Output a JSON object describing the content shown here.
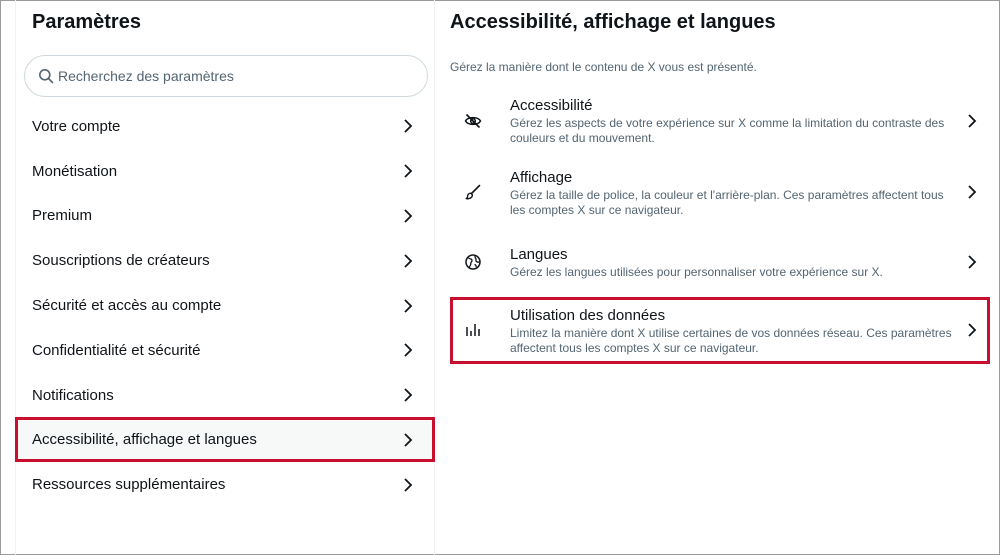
{
  "left": {
    "title": "Paramètres",
    "search_placeholder": "Recherchez des paramètres",
    "items": [
      {
        "label": "Votre compte"
      },
      {
        "label": "Monétisation"
      },
      {
        "label": "Premium"
      },
      {
        "label": "Souscriptions de créateurs"
      },
      {
        "label": "Sécurité et accès au compte"
      },
      {
        "label": "Confidentialité et sécurité"
      },
      {
        "label": "Notifications"
      },
      {
        "label": "Accessibilité, affichage et langues"
      },
      {
        "label": "Ressources supplémentaires"
      }
    ]
  },
  "right": {
    "title": "Accessibilité, affichage et langues",
    "subtitle": "Gérez la manière dont le contenu de X vous est présenté.",
    "options": [
      {
        "label": "Accessibilité",
        "desc": "Gérez les aspects de votre expérience sur X comme la limitation du contraste des couleurs et du mouvement.",
        "icon": "eye-slash-icon"
      },
      {
        "label": "Affichage",
        "desc": "Gérez la taille de police, la couleur et l'arrière-plan. Ces paramètres affectent tous les comptes X sur ce navigateur.",
        "icon": "brush-icon"
      },
      {
        "label": "Langues",
        "desc": "Gérez les langues utilisées pour personnaliser votre expérience sur X.",
        "icon": "globe-icon"
      },
      {
        "label": "Utilisation des données",
        "desc": "Limitez la manière dont X utilise certaines de vos données réseau. Ces paramètres affectent tous les comptes X sur ce navigateur.",
        "icon": "bar-chart-icon"
      }
    ]
  },
  "colors": {
    "highlight": "#c8102e",
    "text": "#0f1419",
    "muted": "#536471"
  }
}
